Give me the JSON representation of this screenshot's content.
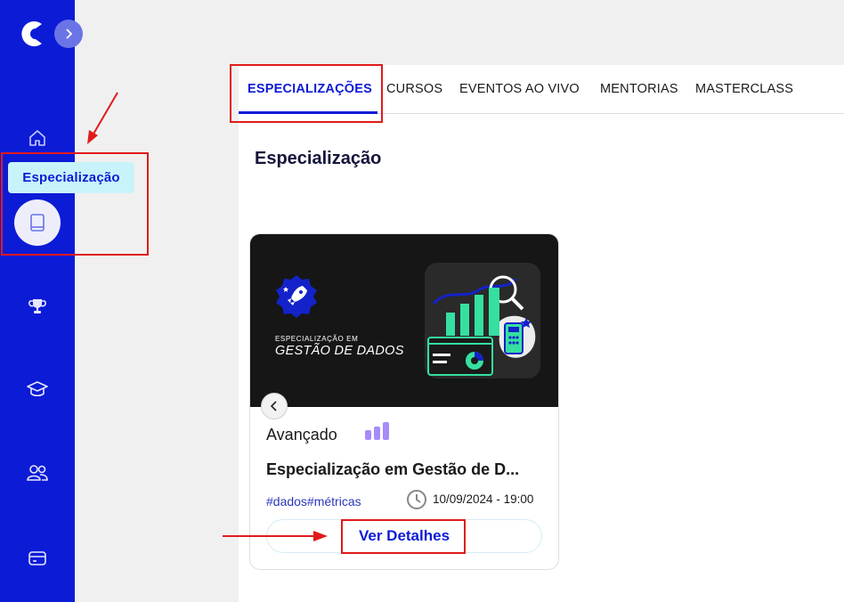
{
  "sidebar": {
    "tooltip": "Especialização",
    "items": [
      {
        "icon": "home-icon"
      },
      {
        "icon": "book-icon",
        "active": true
      },
      {
        "icon": "trophy-icon"
      },
      {
        "icon": "graduation-cap-icon"
      },
      {
        "icon": "users-icon"
      },
      {
        "icon": "card-icon"
      }
    ]
  },
  "tabs": [
    {
      "label": "ESPECIALIZAÇÕES",
      "active": true
    },
    {
      "label": "CURSOS"
    },
    {
      "label": "EVENTOS AO VIVO"
    },
    {
      "label": "MENTORIAS"
    },
    {
      "label": "MASTERCLASS"
    }
  ],
  "page": {
    "title": "Especialização"
  },
  "card": {
    "banner_small": "ESPECIALIZAÇÃO EM",
    "banner_big": "GESTÃO DE DADOS",
    "level": "Avançado",
    "title": "Especialização em Gestão de D...",
    "tags": "#dados#métricas",
    "date": "10/09/2024 - 19:00",
    "button": "Ver Detalhes"
  },
  "colors": {
    "brand": "#0c1bd6",
    "tooltip_bg": "#c9f3fb",
    "annotation": "#e01b1b",
    "level_bars": "#a78bfa"
  }
}
